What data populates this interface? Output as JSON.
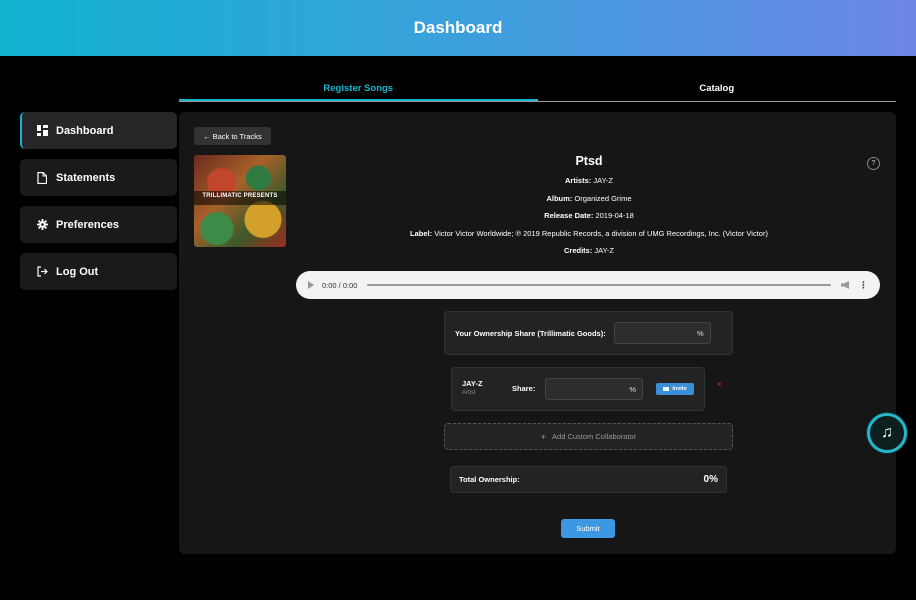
{
  "header": {
    "title": "Dashboard"
  },
  "sidebar": {
    "items": [
      {
        "label": "Dashboard",
        "icon": "dashboard-icon",
        "active": true
      },
      {
        "label": "Statements",
        "icon": "document-icon",
        "active": false
      },
      {
        "label": "Preferences",
        "icon": "gear-icon",
        "active": false
      },
      {
        "label": "Log Out",
        "icon": "logout-icon",
        "active": false
      }
    ]
  },
  "tabs": [
    {
      "label": "Register Songs",
      "active": true
    },
    {
      "label": "Catalog",
      "active": false
    }
  ],
  "back_button": "← Back to Tracks",
  "cover": {
    "text": "TRILLIMATIC PRESENTS"
  },
  "song": {
    "title": "Ptsd",
    "artists_label": "Artists:",
    "artists": "JAY-Z",
    "album_label": "Album:",
    "album": "Organized Grime",
    "release_label": "Release Date:",
    "release": "2019-04-18",
    "label_label": "Label:",
    "label": "Victor Victor Worldwide; ℗ 2019 Republic Records, a division of UMG Recordings, Inc. (Victor Victor)",
    "credits_label": "Credits:",
    "credits": "JAY-Z"
  },
  "help": "?",
  "audio": {
    "time": "0:00 / 0:00"
  },
  "ownership": {
    "label": "Your Ownership Share (Trillimatic Goods):",
    "unit": "%"
  },
  "collaborator": {
    "name": "JAY-Z",
    "role": "Artist",
    "share_label": "Share:",
    "unit": "%",
    "invite_label": "Invite",
    "remove": "×"
  },
  "add_custom": "Add Custom Collaborator",
  "total": {
    "label": "Total Ownership:",
    "value": "0%"
  },
  "submit": "Submit",
  "colors": {
    "accent": "#17b3cf",
    "button": "#3d98e3",
    "danger": "#d9372a"
  }
}
